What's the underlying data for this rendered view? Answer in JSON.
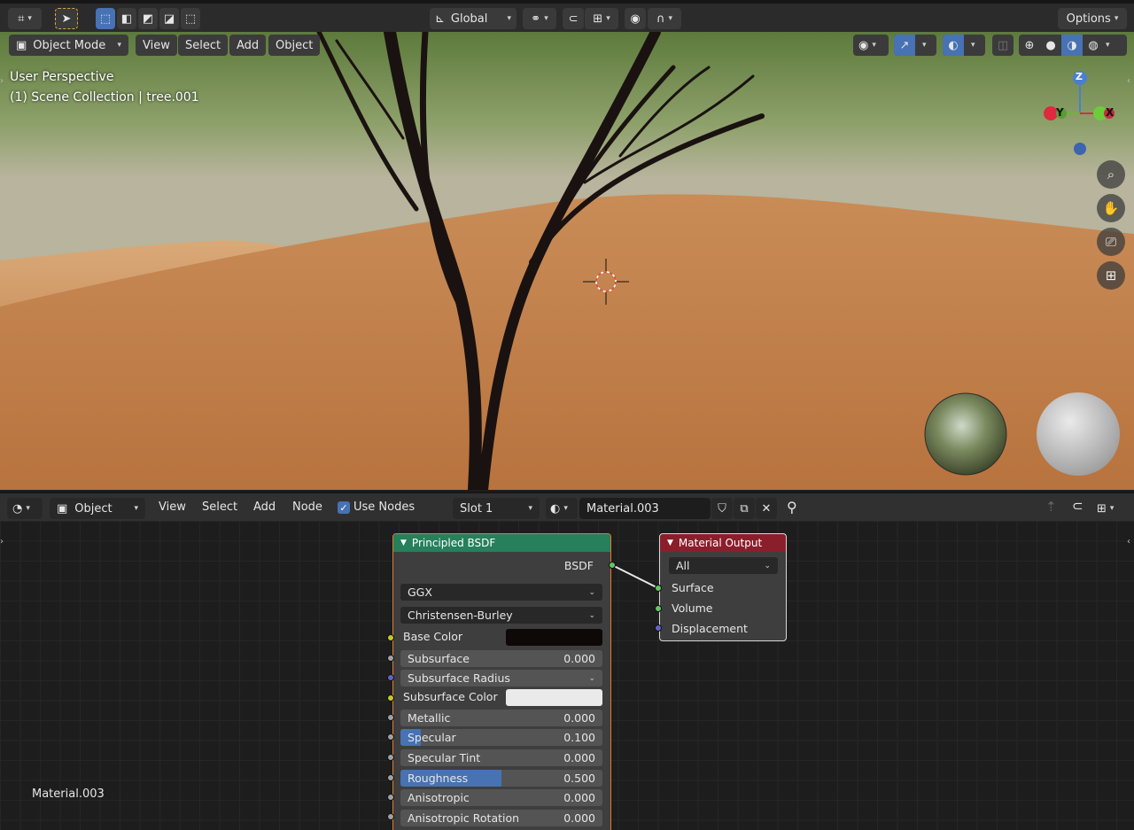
{
  "topbar": {
    "transform_orientation": "Global",
    "options_label": "Options"
  },
  "viewport": {
    "mode_label": "Object Mode",
    "menus": [
      "View",
      "Select",
      "Add",
      "Object"
    ],
    "overlay_title": "User Perspective",
    "overlay_collection": "(1) Scene Collection | tree.001",
    "gizmo": {
      "z": "Z",
      "y": "Y",
      "x": "X"
    }
  },
  "node_editor": {
    "object_type": "Object",
    "menus": [
      "View",
      "Select",
      "Add",
      "Node"
    ],
    "use_nodes_label": "Use Nodes",
    "use_nodes_checked": true,
    "slot_label": "Slot 1",
    "material_name": "Material.003",
    "corner_material_label": "Material.003"
  },
  "bsdf_node": {
    "title": "Principled BSDF",
    "output_label": "BSDF",
    "distribution": "GGX",
    "subsurface_method": "Christensen-Burley",
    "base_color_label": "Base Color",
    "base_color": "#0e0806",
    "subsurface_radius_label": "Subsurface Radius",
    "subsurface_color_label": "Subsurface Color",
    "subsurface_color": "#eaeaea",
    "fields": [
      {
        "label": "Subsurface",
        "value": "0.000",
        "fill": 0
      },
      {
        "label": "Metallic",
        "value": "0.000",
        "fill": 0
      },
      {
        "label": "Specular",
        "value": "0.100",
        "fill": 0.1
      },
      {
        "label": "Specular Tint",
        "value": "0.000",
        "fill": 0
      },
      {
        "label": "Roughness",
        "value": "0.500",
        "fill": 0.5
      },
      {
        "label": "Anisotropic",
        "value": "0.000",
        "fill": 0
      },
      {
        "label": "Anisotropic Rotation",
        "value": "0.000",
        "fill": 0
      }
    ]
  },
  "output_node": {
    "title": "Material Output",
    "target": "All",
    "inputs": [
      "Surface",
      "Volume",
      "Displacement"
    ]
  },
  "colors": {
    "accent": "#4772b3",
    "shader_header": "#25805b",
    "output_header": "#8b1e2b",
    "socket_shader": "#63c763",
    "socket_color": "#c7c729",
    "socket_float": "#a1a1a1",
    "socket_vector": "#6363c7"
  }
}
